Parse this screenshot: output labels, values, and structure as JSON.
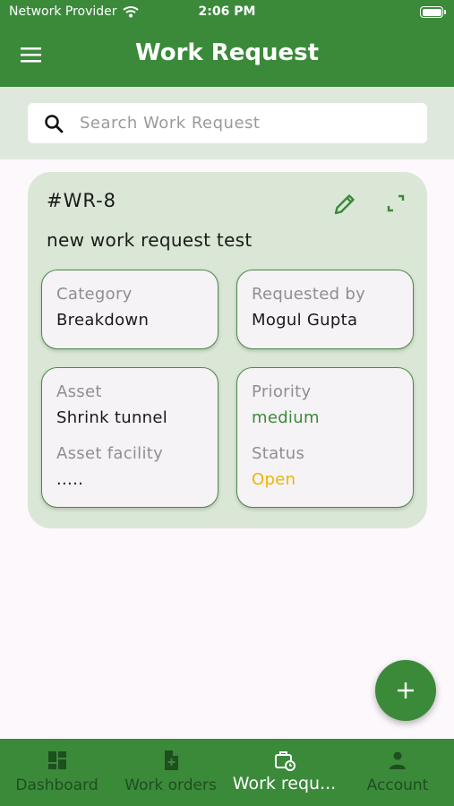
{
  "status_bar": {
    "carrier": "Network Provider",
    "time": "2:06 PM"
  },
  "header": {
    "title": "Work Request",
    "menu_icon": "hamburger-menu-icon"
  },
  "search": {
    "placeholder": "Search Work Request",
    "value": "",
    "icon": "search-icon"
  },
  "work_request": {
    "id": "#WR-8",
    "title": "new work request test",
    "category_label": "Category",
    "category": "Breakdown",
    "requested_by_label": "Requested by",
    "requested_by": "Mogul Gupta",
    "asset_label": "Asset",
    "asset": "Shrink tunnel",
    "asset_facility_label": "Asset facility",
    "asset_facility": ".....",
    "priority_label": "Priority",
    "priority": "medium",
    "status_label": "Status",
    "status": "Open",
    "edit_icon": "pencil-icon",
    "expand_icon": "expand-icon"
  },
  "fab": {
    "icon": "plus-icon"
  },
  "bottom_nav": {
    "items": [
      {
        "label": "Dashboard",
        "icon": "dashboard-icon",
        "active": false
      },
      {
        "label": "Work orders",
        "icon": "document-add-icon",
        "active": false
      },
      {
        "label": "Work requ...",
        "icon": "briefcase-clock-icon",
        "active": true
      },
      {
        "label": "Account",
        "icon": "person-icon",
        "active": false
      }
    ]
  },
  "colors": {
    "primary": "#3a8a3a",
    "priority_medium": "#3a8a3a",
    "status_open": "#f0b400",
    "card_bg": "#dae7d6"
  }
}
